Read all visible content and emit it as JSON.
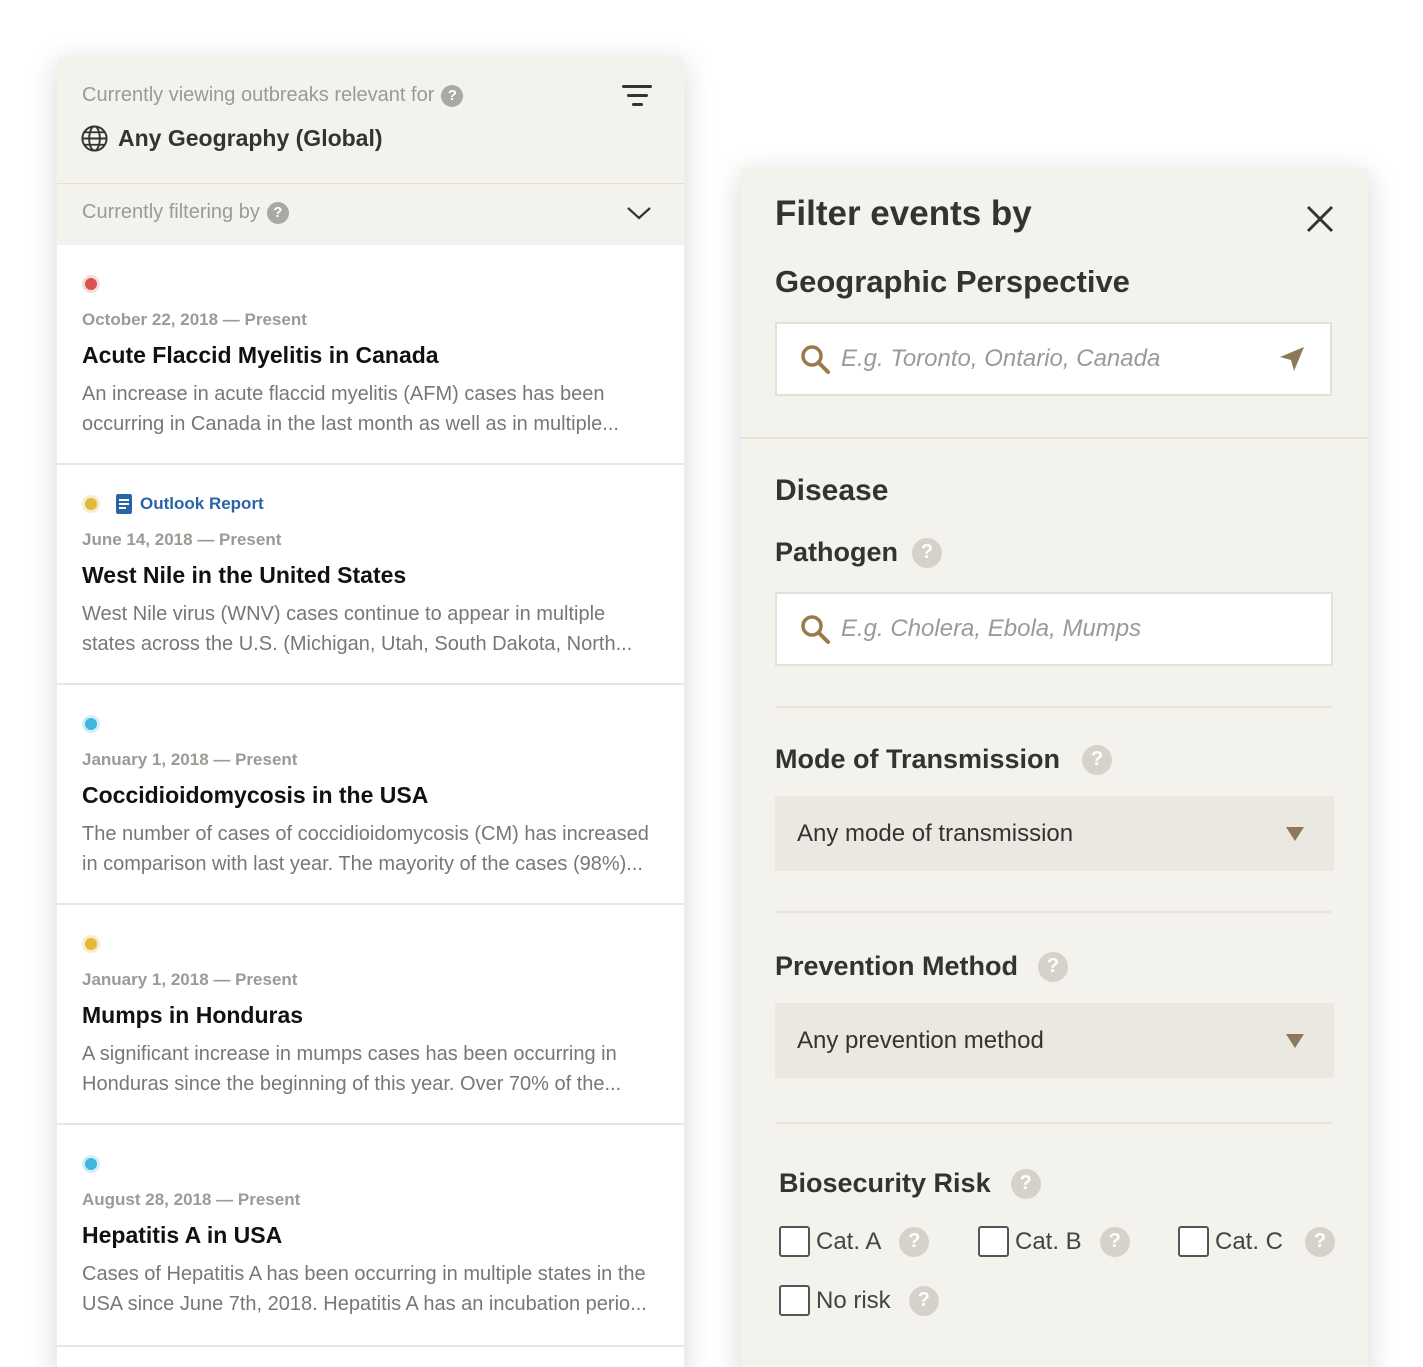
{
  "outbreaks": {
    "viewing_caption": "Currently viewing outbreaks relevant for",
    "geography": "Any Geography (Global)",
    "filtering_caption": "Currently filtering by",
    "events": [
      {
        "status_color": "red",
        "report_label": "",
        "date": "October 22, 2018 — Present",
        "title": "Acute Flaccid Myelitis in Canada",
        "description": "An increase in acute flaccid myelitis (AFM) cases has been occurring in Canada in the last month as well as in multiple..."
      },
      {
        "status_color": "yellow",
        "report_label": "Outlook Report",
        "date": "June 14, 2018 — Present",
        "title": "West Nile in the United States",
        "description": "West Nile virus (WNV) cases continue to appear in multiple states across the U.S. (Michigan, Utah, South Dakota, North..."
      },
      {
        "status_color": "blue",
        "report_label": "",
        "date": "January 1, 2018 — Present",
        "title": "Coccidioidomycosis in the USA",
        "description": "The number of cases of coccidioidomycosis (CM) has increased in comparison with last year. The mayority of the cases (98%)..."
      },
      {
        "status_color": "yellow",
        "report_label": "",
        "date": "January 1, 2018 — Present",
        "title": "Mumps in Honduras",
        "description": "A significant increase in mumps cases has been occurring in Honduras since the beginning of this year. Over 70% of the..."
      },
      {
        "status_color": "blue",
        "report_label": "",
        "date": "August 28, 2018 — Present",
        "title": "Hepatitis A in USA",
        "description": "Cases of Hepatitis A has been occurring in multiple states in the USA since June 7th, 2018. Hepatitis A has an incubation perio..."
      }
    ]
  },
  "filter_panel": {
    "title": "Filter events by",
    "geo_section": "Geographic Perspective",
    "geo_placeholder": "E.g. Toronto, Ontario, Canada",
    "disease_section": "Disease",
    "pathogen_label": "Pathogen",
    "pathogen_placeholder": "E.g. Cholera, Ebola, Mumps",
    "transmission_label": "Mode of Transmission",
    "transmission_value": "Any mode of transmission",
    "prevention_label": "Prevention Method",
    "prevention_value": "Any prevention method",
    "biosecurity_label": "Biosecurity Risk",
    "risk_options": [
      "Cat. A",
      "Cat. B",
      "Cat. C",
      "No risk"
    ]
  },
  "help_glyph": "?",
  "colors": {
    "panel_bg": "#f4f2ec",
    "status_red": "#d9534f",
    "status_yellow": "#e0b93e",
    "status_blue": "#3fb6dd",
    "link_blue": "#2a64a8"
  }
}
